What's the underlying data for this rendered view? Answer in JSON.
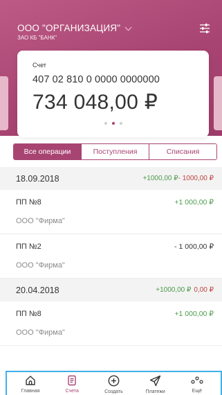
{
  "header": {
    "org_name": "ООО \"ОРГАНИЗАЦИЯ\"",
    "bank_name": "ЗАО КБ \"БАНК\"",
    "icons": {
      "dropdown": "chevron-down-icon",
      "filter": "sliders-icon"
    }
  },
  "account_card": {
    "label": "Счет",
    "number": "407 02 810 0 0000 0000000",
    "balance": "734 048,00 ₽",
    "carousel": {
      "count": 3,
      "active": 2
    }
  },
  "tabs": [
    {
      "label": "Все операции",
      "active": true
    },
    {
      "label": "Поступления",
      "active": false
    },
    {
      "label": "Списания",
      "active": false
    }
  ],
  "groups": [
    {
      "date": "18.09.2018",
      "income": "+1000,00 ₽",
      "outcome": "- 1000,00 ₽",
      "items": [
        {
          "title": "ПП №8",
          "counterparty": "ООО \"Фирма\"",
          "amount": "+1 000,00 ₽",
          "direction": "in"
        },
        {
          "title": "ПП №2",
          "counterparty": "ООО \"Фирма\"",
          "amount": "- 1 000,00 ₽",
          "direction": "out"
        }
      ]
    },
    {
      "date": "20.04.2018",
      "income": "+1000,00 ₽",
      "outcome": "0,00 ₽",
      "items": [
        {
          "title": "ПП №8",
          "counterparty": "ООО \"Фирма\"",
          "amount": "+1 000,00 ₽",
          "direction": "in"
        }
      ]
    }
  ],
  "bottom_nav": [
    {
      "label": "Главная",
      "icon": "home-icon",
      "active": false
    },
    {
      "label": "Счета",
      "icon": "document-icon",
      "active": true
    },
    {
      "label": "Создать",
      "icon": "plus-circle-icon",
      "active": false
    },
    {
      "label": "Платежи",
      "icon": "send-icon",
      "active": false
    },
    {
      "label": "Ещё",
      "icon": "more-dots-icon",
      "active": false
    }
  ],
  "colors": {
    "brand": "#a84472",
    "income": "#4b9a4b",
    "outcome": "#c24242",
    "nav_border": "#3fb0e8"
  }
}
